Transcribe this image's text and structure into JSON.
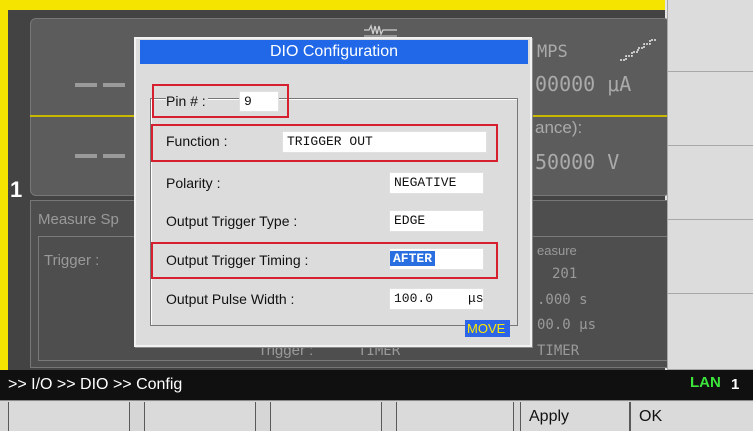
{
  "channel": "1",
  "background": {
    "amps_label": "MPS",
    "current_value": "00000 μA",
    "ance_label": "ance):",
    "voltage_value": "50000  V",
    "measure_sp_label": "Measure Sp",
    "trigger_label": "Trigger :",
    "measure_col": "easure",
    "count_value": "201",
    "time_value": ".000  s",
    "pulse_value": "00.0 μs",
    "trigger_bottom_label": "Trigger :",
    "trigger_bottom_value1": "TIMER",
    "trigger_bottom_value2": "TIMER"
  },
  "dialog": {
    "title": "DIO Configuration",
    "pin_label": "Pin # :",
    "pin_value": "9",
    "function_label": "Function :",
    "function_value": "TRIGGER OUT",
    "polarity_label": "Polarity :",
    "polarity_value": "NEGATIVE",
    "trigger_type_label": "Output Trigger Type :",
    "trigger_type_value": "EDGE",
    "trigger_timing_label": "Output Trigger Timing :",
    "trigger_timing_value": "AFTER",
    "pulse_width_label": "Output Pulse Width :",
    "pulse_width_value": "100.0",
    "pulse_width_unit": "μs",
    "move_badge": "MOVE"
  },
  "status_bar": {
    "path": ">> I/O >> DIO >> Config",
    "lan": "LAN",
    "lan_count": "1"
  },
  "softkeys": {
    "apply": "Apply",
    "ok": "OK"
  },
  "colors": {
    "title_bar": "#2068e8",
    "highlight_box": "#d62030",
    "frame_yellow": "#f5e400",
    "lan_green": "#3ce43c"
  }
}
